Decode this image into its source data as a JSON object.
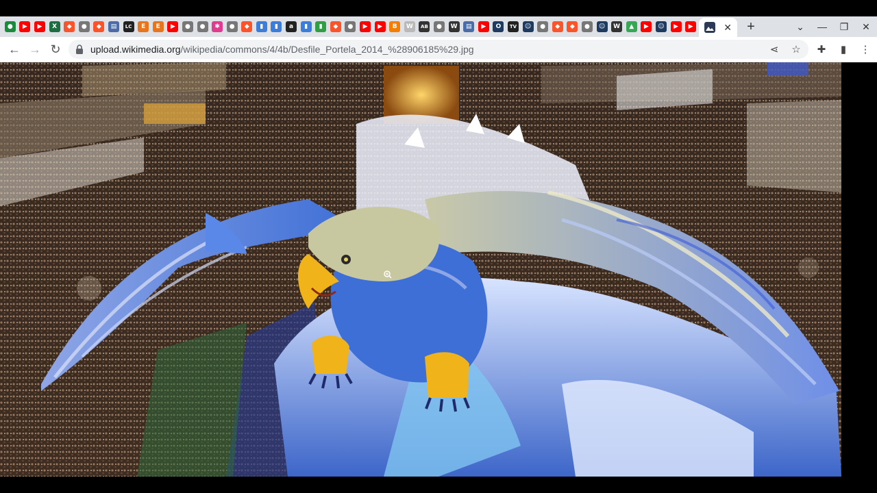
{
  "tabs": [
    {
      "icon": "globe-icon",
      "color": "#1a8b3c",
      "glyph": "●"
    },
    {
      "icon": "youtube-icon",
      "color": "#ff0000",
      "glyph": "▶"
    },
    {
      "icon": "youtube-icon",
      "color": "#ff0000",
      "glyph": "▶"
    },
    {
      "icon": "excel-icon",
      "color": "#1d6f42",
      "glyph": "X"
    },
    {
      "icon": "brave-icon",
      "color": "#fb542b",
      "glyph": "◆"
    },
    {
      "icon": "chrome-icon",
      "color": "#777777",
      "glyph": "●"
    },
    {
      "icon": "brave-icon",
      "color": "#fb542b",
      "glyph": "◆"
    },
    {
      "icon": "chart-icon",
      "color": "#4a6da7",
      "glyph": "▤"
    },
    {
      "icon": "lc-icon",
      "color": "#222222",
      "glyph": "LC"
    },
    {
      "icon": "e-icon",
      "color": "#e8741c",
      "glyph": "E"
    },
    {
      "icon": "e-icon",
      "color": "#e8741c",
      "glyph": "E"
    },
    {
      "icon": "youtube-icon",
      "color": "#ff0000",
      "glyph": "▶"
    },
    {
      "icon": "chrome-icon",
      "color": "#777777",
      "glyph": "●"
    },
    {
      "icon": "chrome-icon",
      "color": "#777777",
      "glyph": "●"
    },
    {
      "icon": "flower-icon",
      "color": "#e23a8f",
      "glyph": "✱"
    },
    {
      "icon": "chrome-icon",
      "color": "#777777",
      "glyph": "●"
    },
    {
      "icon": "brave-icon",
      "color": "#fb542b",
      "glyph": "◆"
    },
    {
      "icon": "shopping-icon",
      "color": "#3b7dd8",
      "glyph": "▮"
    },
    {
      "icon": "shopping-icon",
      "color": "#3b7dd8",
      "glyph": "▮"
    },
    {
      "icon": "amazon-icon",
      "color": "#222222",
      "glyph": "a"
    },
    {
      "icon": "shopping-icon",
      "color": "#3b7dd8",
      "glyph": "▮"
    },
    {
      "icon": "shopping-icon",
      "color": "#2f9e44",
      "glyph": "▮"
    },
    {
      "icon": "brave-icon",
      "color": "#fb542b",
      "glyph": "◆"
    },
    {
      "icon": "chrome-icon",
      "color": "#777777",
      "glyph": "●"
    },
    {
      "icon": "youtube-icon",
      "color": "#ff0000",
      "glyph": "▶"
    },
    {
      "icon": "youtube-icon",
      "color": "#ff0000",
      "glyph": "▶"
    },
    {
      "icon": "blogger-icon",
      "color": "#f57d00",
      "glyph": "B"
    },
    {
      "icon": "w-icon",
      "color": "#b9b9b9",
      "glyph": "W"
    },
    {
      "icon": "ab-icon",
      "color": "#333333",
      "glyph": "AB"
    },
    {
      "icon": "chrome-icon",
      "color": "#777777",
      "glyph": "●"
    },
    {
      "icon": "wikipedia-icon",
      "color": "#333333",
      "glyph": "W"
    },
    {
      "icon": "chart-icon",
      "color": "#4a6da7",
      "glyph": "▤"
    },
    {
      "icon": "youtube-icon",
      "color": "#ff0000",
      "glyph": "▶"
    },
    {
      "icon": "o-icon",
      "color": "#1e3a5f",
      "glyph": "O"
    },
    {
      "icon": "tv-icon",
      "color": "#222222",
      "glyph": "TV"
    },
    {
      "icon": "person-icon",
      "color": "#1e3a5f",
      "glyph": "☺"
    },
    {
      "icon": "chrome-icon",
      "color": "#777777",
      "glyph": "●"
    },
    {
      "icon": "brave-icon",
      "color": "#fb542b",
      "glyph": "◆"
    },
    {
      "icon": "brave-icon",
      "color": "#fb542b",
      "glyph": "◆"
    },
    {
      "icon": "chrome-icon",
      "color": "#777777",
      "glyph": "●"
    },
    {
      "icon": "person-icon",
      "color": "#1e3a5f",
      "glyph": "☺"
    },
    {
      "icon": "wikipedia-icon",
      "color": "#333333",
      "glyph": "W"
    },
    {
      "icon": "drive-icon",
      "color": "#34a853",
      "glyph": "▲"
    },
    {
      "icon": "youtube-icon",
      "color": "#ff0000",
      "glyph": "▶"
    },
    {
      "icon": "person-icon",
      "color": "#1e3a5f",
      "glyph": "☺"
    },
    {
      "icon": "youtube-icon",
      "color": "#ff0000",
      "glyph": "▶"
    },
    {
      "icon": "youtube-icon",
      "color": "#ff0000",
      "glyph": "▶"
    }
  ],
  "active_tab": {
    "icon": "photo-icon",
    "close_glyph": "✕"
  },
  "new_tab_glyph": "+",
  "window_controls": {
    "dropdown": "⌄",
    "minimize": "—",
    "restore": "❐",
    "close": "✕"
  },
  "nav": {
    "back": "←",
    "forward": "→",
    "reload": "↻"
  },
  "address": {
    "host": "upload.wikimedia.org",
    "path": "/wikipedia/commons/4/4b/Desfile_Portela_2014_%28906185%29.jpg"
  },
  "omnibox_icons": {
    "share": "⋖",
    "bookmark": "☆"
  },
  "toolbar_icons": {
    "extensions": "✚",
    "sidepanel": "▮",
    "menu": "⋮"
  },
  "colors": {
    "eagle_blue": "#3e6fd6",
    "eagle_light": "#b8c6f0",
    "beak": "#f0b319",
    "float_glow": "#d7a13a",
    "crowd": "#3a2a1e"
  }
}
